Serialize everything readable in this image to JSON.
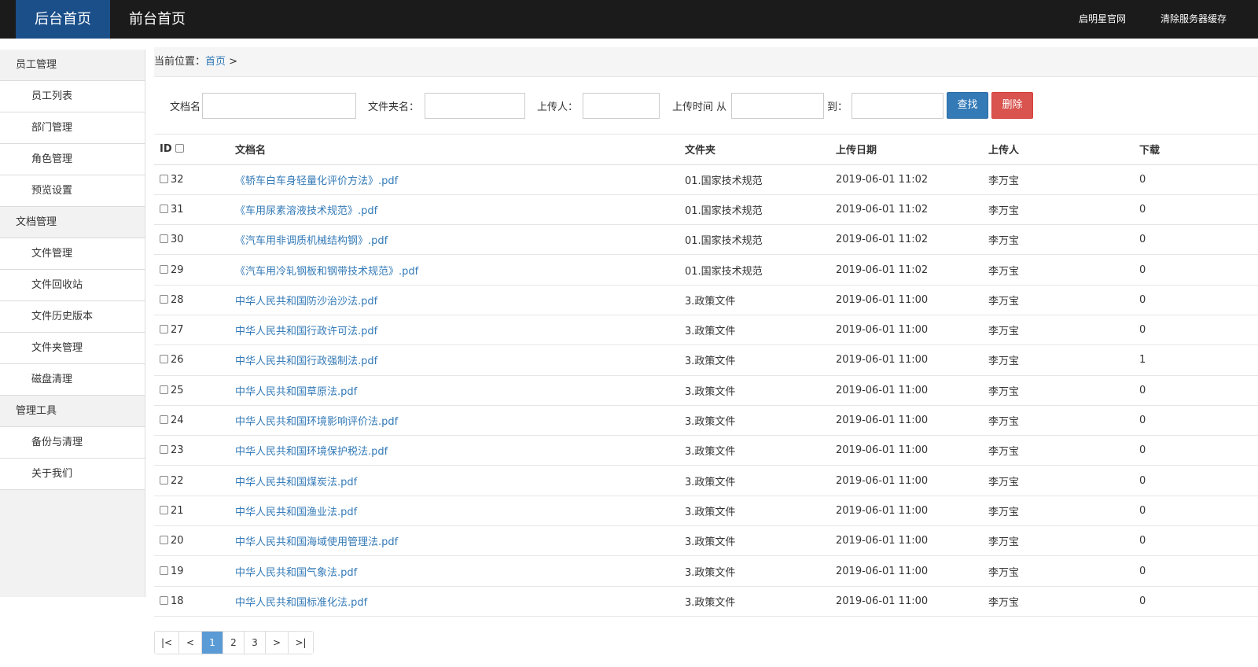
{
  "topbar": {
    "left": [
      "后台首页",
      "前台首页"
    ],
    "right": [
      "启明星官网",
      "清除服务器缓存"
    ]
  },
  "sidebar": {
    "groups": [
      {
        "title": "员工管理",
        "items": [
          "员工列表",
          "部门管理",
          "角色管理",
          "预览设置"
        ]
      },
      {
        "title": "文档管理",
        "items": [
          "文件管理",
          "文件回收站",
          "文件历史版本",
          "文件夹管理",
          "磁盘清理"
        ]
      },
      {
        "title": "管理工具",
        "items": [
          "备份与清理",
          "关于我们"
        ]
      }
    ]
  },
  "breadcrumb": {
    "prefix": "当前位置：",
    "home": "首页",
    "sep": " >"
  },
  "filter": {
    "doc_name_label": "文档名",
    "folder_label": "文件夹名：",
    "uploader_label": "上传人：",
    "time_label": "上传时间 从",
    "to_label": "到：",
    "search_btn": "查找",
    "delete_btn": "删除"
  },
  "table": {
    "headers": {
      "id": "ID",
      "name": "文档名",
      "folder": "文件夹",
      "date": "上传日期",
      "uploader": "上传人",
      "downloads": "下载"
    },
    "rows": [
      {
        "id": "32",
        "name": "《轿车白车身轻量化评价方法》.pdf",
        "folder": "01.国家技术规范",
        "date": "2019-06-01 11:02",
        "uploader": "李万宝",
        "downloads": "0"
      },
      {
        "id": "31",
        "name": "《车用尿素溶液技术规范》.pdf",
        "folder": "01.国家技术规范",
        "date": "2019-06-01 11:02",
        "uploader": "李万宝",
        "downloads": "0"
      },
      {
        "id": "30",
        "name": "《汽车用非调质机械结构钢》.pdf",
        "folder": "01.国家技术规范",
        "date": "2019-06-01 11:02",
        "uploader": "李万宝",
        "downloads": "0"
      },
      {
        "id": "29",
        "name": "《汽车用冷轧钢板和钢带技术规范》.pdf",
        "folder": "01.国家技术规范",
        "date": "2019-06-01 11:02",
        "uploader": "李万宝",
        "downloads": "0"
      },
      {
        "id": "28",
        "name": "中华人民共和国防沙治沙法.pdf",
        "folder": "3.政策文件",
        "date": "2019-06-01 11:00",
        "uploader": "李万宝",
        "downloads": "0"
      },
      {
        "id": "27",
        "name": "中华人民共和国行政许可法.pdf",
        "folder": "3.政策文件",
        "date": "2019-06-01 11:00",
        "uploader": "李万宝",
        "downloads": "0"
      },
      {
        "id": "26",
        "name": "中华人民共和国行政强制法.pdf",
        "folder": "3.政策文件",
        "date": "2019-06-01 11:00",
        "uploader": "李万宝",
        "downloads": "1"
      },
      {
        "id": "25",
        "name": "中华人民共和国草原法.pdf",
        "folder": "3.政策文件",
        "date": "2019-06-01 11:00",
        "uploader": "李万宝",
        "downloads": "0"
      },
      {
        "id": "24",
        "name": "中华人民共和国环境影响评价法.pdf",
        "folder": "3.政策文件",
        "date": "2019-06-01 11:00",
        "uploader": "李万宝",
        "downloads": "0"
      },
      {
        "id": "23",
        "name": "中华人民共和国环境保护税法.pdf",
        "folder": "3.政策文件",
        "date": "2019-06-01 11:00",
        "uploader": "李万宝",
        "downloads": "0"
      },
      {
        "id": "22",
        "name": "中华人民共和国煤炭法.pdf",
        "folder": "3.政策文件",
        "date": "2019-06-01 11:00",
        "uploader": "李万宝",
        "downloads": "0"
      },
      {
        "id": "21",
        "name": "中华人民共和国渔业法.pdf",
        "folder": "3.政策文件",
        "date": "2019-06-01 11:00",
        "uploader": "李万宝",
        "downloads": "0"
      },
      {
        "id": "20",
        "name": "中华人民共和国海域使用管理法.pdf",
        "folder": "3.政策文件",
        "date": "2019-06-01 11:00",
        "uploader": "李万宝",
        "downloads": "0"
      },
      {
        "id": "19",
        "name": "中华人民共和国气象法.pdf",
        "folder": "3.政策文件",
        "date": "2019-06-01 11:00",
        "uploader": "李万宝",
        "downloads": "0"
      },
      {
        "id": "18",
        "name": "中华人民共和国标准化法.pdf",
        "folder": "3.政策文件",
        "date": "2019-06-01 11:00",
        "uploader": "李万宝",
        "downloads": "0"
      }
    ]
  },
  "pager": {
    "items": [
      "|<",
      "<",
      "1",
      "2",
      "3",
      ">",
      ">|"
    ],
    "current": "1"
  },
  "colors": {
    "topbar": "#1b1b1b",
    "active_nav": "#1a4f8a",
    "link": "#337ab7",
    "search": "#337ab7",
    "delete": "#d9534f"
  }
}
